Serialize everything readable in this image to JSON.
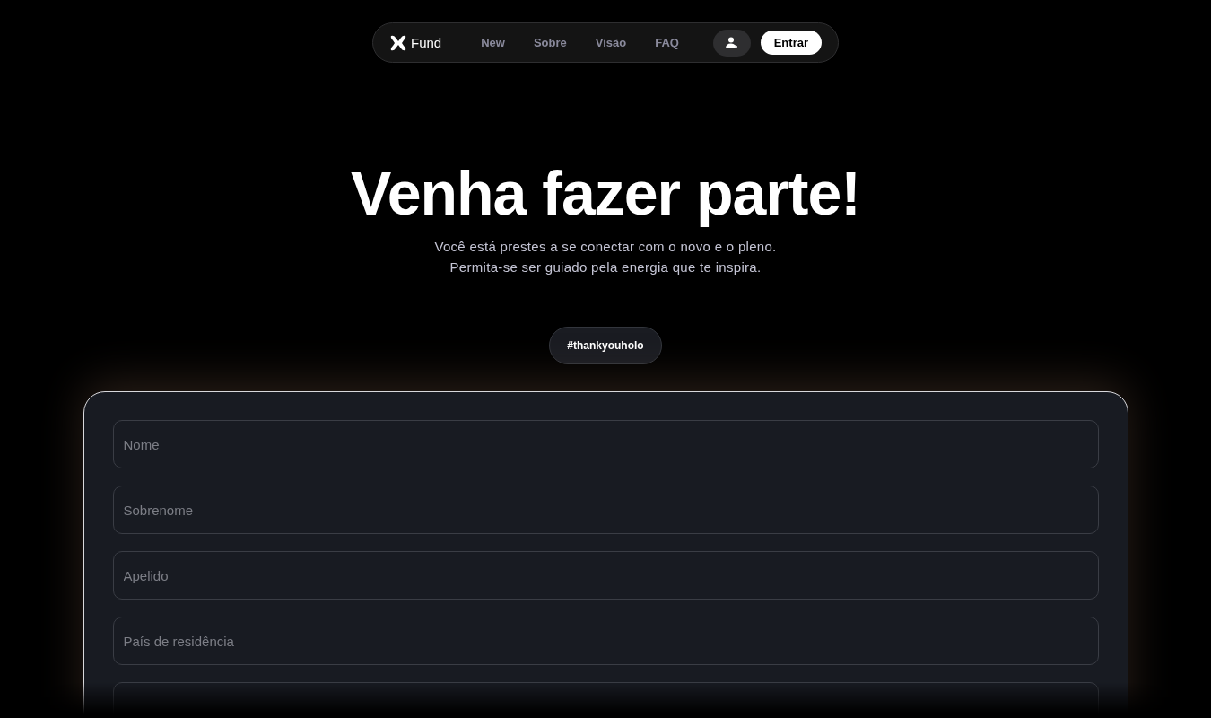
{
  "nav": {
    "brand": "Fund",
    "links": [
      {
        "label": "New"
      },
      {
        "label": "Sobre"
      },
      {
        "label": "Visão"
      },
      {
        "label": "FAQ"
      }
    ],
    "login": "Entrar"
  },
  "hero": {
    "title": "Venha fazer parte!",
    "subtitle": [
      "Você está prestes a se conectar com o novo e o pleno.",
      "Permita-se ser guiado pela energia que te inspira."
    ],
    "tag": "#thankyouholo"
  },
  "form": {
    "fields": [
      {
        "kind": "text",
        "placeholder": "Nome"
      },
      {
        "kind": "text",
        "placeholder": "Sobrenome"
      },
      {
        "kind": "text",
        "placeholder": "Apelido"
      },
      {
        "kind": "text",
        "placeholder": "País de residência"
      },
      {
        "kind": "cut"
      }
    ]
  }
}
